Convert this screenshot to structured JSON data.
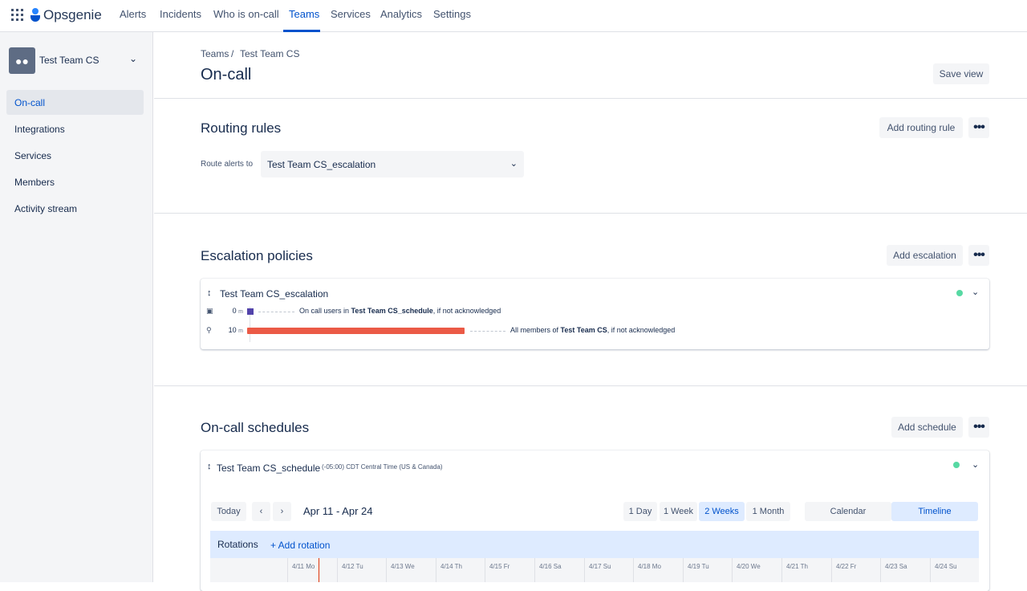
{
  "topnav": {
    "brand": "Opsgenie",
    "links": [
      "Alerts",
      "Incidents",
      "Who is on-call",
      "Teams",
      "Services",
      "Analytics",
      "Settings"
    ],
    "active": "Teams"
  },
  "sidebar": {
    "team_name": "Test Team CS",
    "items": [
      {
        "label": "On-call",
        "active": true
      },
      {
        "label": "Integrations",
        "active": false
      },
      {
        "label": "Services",
        "active": false
      },
      {
        "label": "Members",
        "active": false
      },
      {
        "label": "Activity stream",
        "active": false
      }
    ]
  },
  "breadcrumb": [
    "Teams",
    "/",
    "Test Team CS"
  ],
  "page": {
    "title": "On-call",
    "save_view": "Save view"
  },
  "routing": {
    "title": "Routing rules",
    "add_button": "Add routing rule",
    "route_label": "Route alerts to",
    "route_value": "Test Team CS_escalation"
  },
  "escalation": {
    "title": "Escalation policies",
    "add_button": "Add escalation",
    "policy_name": "Test Team CS_escalation",
    "rules": [
      {
        "time": "0",
        "unit": "m",
        "pre": "On call users in ",
        "target": "Test Team CS_schedule",
        "post": ", if not acknowledged"
      },
      {
        "time": "10",
        "unit": "m",
        "pre": "All members of ",
        "target": "Test Team CS",
        "post": ", if not acknowledged"
      }
    ]
  },
  "schedules": {
    "title": "On-call schedules",
    "add_button": "Add schedule",
    "schedule_name": "Test Team CS_schedule",
    "timezone": "(-05:00) CDT Central Time (US & Canada)",
    "today": "Today",
    "prev": "‹",
    "next": "›",
    "range": "Apr 11 - Apr 24",
    "spans": [
      "1 Day",
      "1 Week",
      "2 Weeks",
      "1 Month"
    ],
    "selected_span": "2 Weeks",
    "views": [
      "Calendar",
      "Timeline"
    ],
    "selected_view": "Timeline",
    "rotations_label": "Rotations",
    "add_rotation": "+ Add rotation",
    "days": [
      "4/11 Mo",
      "4/12 Tu",
      "4/13 We",
      "4/14 Th",
      "4/15 Fr",
      "4/16 Sa",
      "4/17 Su",
      "4/18 Mo",
      "4/19 Tu",
      "4/20 We",
      "4/21 Th",
      "4/22 Fr",
      "4/23 Sa",
      "4/24 Su"
    ]
  },
  "icons": {
    "apps": "grid-icon",
    "team": "team-icon",
    "more": "more-icon"
  },
  "colors": {
    "accent": "#0052cc",
    "status_on": "#57d9a3",
    "escalation_user": "#5243aa",
    "escalation_team": "#eb5a46"
  }
}
